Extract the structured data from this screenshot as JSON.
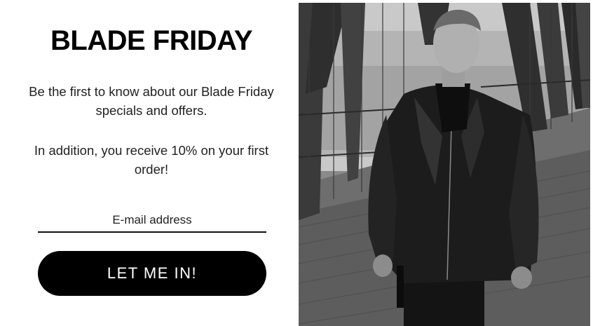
{
  "modal": {
    "title": "BLADE FRIDAY",
    "description_line1": "Be the first to know about our Blade Friday specials and offers.",
    "description_line2": "In addition, you receive 10% on your first order!",
    "email": {
      "placeholder": "E-mail address",
      "value": ""
    },
    "cta_label": "LET ME IN!"
  },
  "image": {
    "subject": "man-in-black-leather-jacket",
    "style": "black-and-white"
  },
  "colors": {
    "primary": "#000000",
    "background": "#ffffff",
    "text": "#222222",
    "button_text": "#ffffff"
  }
}
